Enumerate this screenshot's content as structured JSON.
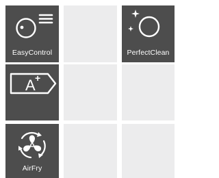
{
  "tiles": [
    {
      "label": "EasyControl",
      "icon": "easycontrol-icon",
      "style": "dark"
    },
    {
      "label": "",
      "style": "light"
    },
    {
      "label": "PerfectClean",
      "icon": "perfectclean-icon",
      "style": "dark"
    },
    {
      "label": "",
      "icon": "energy-class-icon",
      "style": "dark",
      "energy_class": "A",
      "energy_suffix": "+"
    },
    {
      "label": "",
      "style": "light"
    },
    {
      "label": "",
      "style": "light"
    },
    {
      "label": "AirFry",
      "icon": "airfry-icon",
      "style": "dark"
    },
    {
      "label": "",
      "style": "light"
    },
    {
      "label": "",
      "style": "light"
    }
  ],
  "colors": {
    "tile_dark": "#4d4d4d",
    "tile_light": "#ececed",
    "icon": "#ffffff"
  }
}
